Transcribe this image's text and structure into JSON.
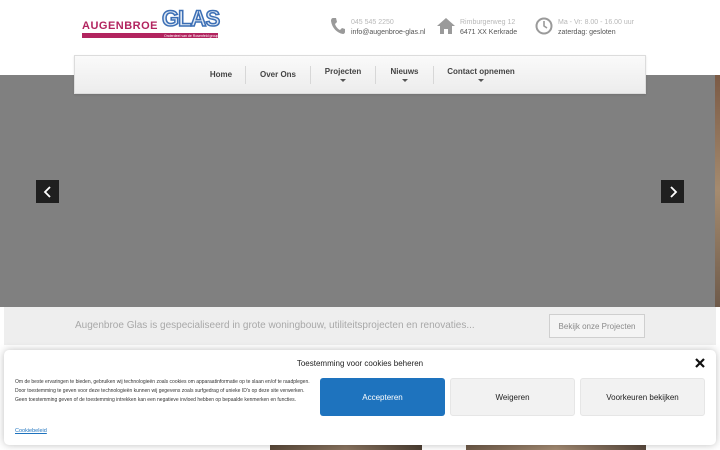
{
  "logo": {
    "brand": "AUGENBROE",
    "glas": "GLAS",
    "tagline": "Onderdeel van de Rosenfeld group"
  },
  "contact": {
    "phone": "045 545 2250",
    "email": "info@augenbroe-glas.nl",
    "street": "Rimburgerweg 12",
    "city": "6471 XX Kerkrade",
    "hours": "Ma - Vr: 8.00 - 16.00 uur",
    "saturday": "zaterdag: gesloten"
  },
  "nav": {
    "items": [
      {
        "label": "Home"
      },
      {
        "label": "Over Ons"
      },
      {
        "label": "Projecten"
      },
      {
        "label": "Nieuws"
      },
      {
        "label": "Contact opnemen"
      }
    ]
  },
  "band": {
    "tagline": "Augenbroe Glas is gespecialiseerd in grote woningbouw, utiliteitsprojecten en renovaties...",
    "button": "Bekijk onze Projecten"
  },
  "cookie": {
    "title": "Toestemming voor cookies beheren",
    "text": "Om de beste ervaringen te bieden, gebruiken wij technologieën zoals cookies om apparaatinformatie op te slaan en/of te raadplegen. Door toestemming te geven voor deze technologieën kunnen wij gegevens zoals surfgedrag of unieke ID's op deze site verwerken. Geen toestemming geven of de toestemming intrekken kan een negatieve invloed hebben op bepaalde kenmerken en functies.",
    "accept": "Accepteren",
    "deny": "Weigeren",
    "preferences": "Voorkeuren bekijken",
    "policy": "Cookiebeleid"
  },
  "colors": {
    "accent": "#1e73be",
    "brand": "#b2245f",
    "slider": "#808080"
  }
}
